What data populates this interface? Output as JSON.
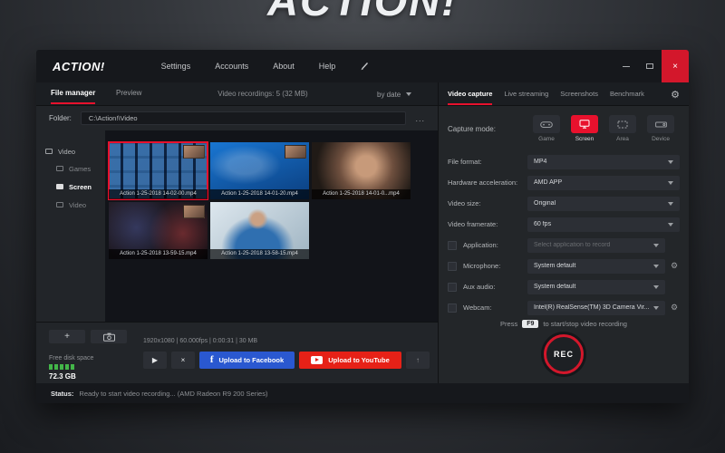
{
  "background": {
    "logo_text": "ACTION!"
  },
  "titlebar": {
    "logo": "ACTION!",
    "menu": [
      "Settings",
      "Accounts",
      "About",
      "Help"
    ],
    "close": "×"
  },
  "left_panel": {
    "tabs": {
      "file_manager": "File manager",
      "preview": "Preview"
    },
    "summary": "Video recordings: 5 (32 MB)",
    "sort_label": "by date",
    "folder_label": "Folder:",
    "folder_path": "C:\\Action!\\Video",
    "browse": "...",
    "tree": {
      "root": "Video",
      "items": [
        "Games",
        "Screen",
        "Video"
      ]
    },
    "thumbnails": [
      {
        "caption": "Action 1-25-2018 14-02-00.mp4"
      },
      {
        "caption": "Action 1-25-2018 14-01-20.mp4"
      },
      {
        "caption": "Action 1-25-2018 14-01-0...mp4"
      },
      {
        "caption": "Action 1-25-2018 13-59-15.mp4"
      },
      {
        "caption": "Action 1-25-2018 13-58-15.mp4"
      }
    ],
    "add_button": "+",
    "file_info": "1920x1080 | 60.000fps | 0:00:31 | 30 MB",
    "play_icon": "▶",
    "close_icon": "×",
    "facebook_icon": "f",
    "facebook_button": "Upload to Facebook",
    "youtube_button": "Upload to YouTube",
    "upload_arrow": "↑",
    "disk_label": "Free disk space",
    "disk_value": "72.3 GB"
  },
  "right_panel": {
    "tabs": [
      "Video capture",
      "Live streaming",
      "Screenshots",
      "Benchmark"
    ],
    "gear_icon": "⚙",
    "capture_mode_label": "Capture mode:",
    "modes": [
      "Game",
      "Screen",
      "Area",
      "Device"
    ],
    "settings": [
      {
        "label": "File format:",
        "value": "MP4"
      },
      {
        "label": "Hardware acceleration:",
        "value": "AMD APP"
      },
      {
        "label": "Video size:",
        "value": "Original"
      },
      {
        "label": "Video framerate:",
        "value": "60 fps"
      },
      {
        "label": "Application:",
        "value": "Select application to record"
      },
      {
        "label": "Microphone:",
        "value": "System default"
      },
      {
        "label": "Aux audio:",
        "value": "System default"
      },
      {
        "label": "Webcam:",
        "value": "Intel(R) RealSense(TM) 3D Camera Vir..."
      }
    ],
    "hotkey_pre": "Press",
    "hotkey_key": "F9",
    "hotkey_post": "to start/stop video recording",
    "rec_label": "REC"
  },
  "statusbar": {
    "label": "Status:",
    "text": "Ready to start video recording... (AMD Radeon R9 200 Series)"
  },
  "colors": {
    "accent_red": "#e8112d",
    "facebook_blue": "#2a58d0",
    "youtube_red": "#e62117",
    "disk_green": "#43b649"
  }
}
